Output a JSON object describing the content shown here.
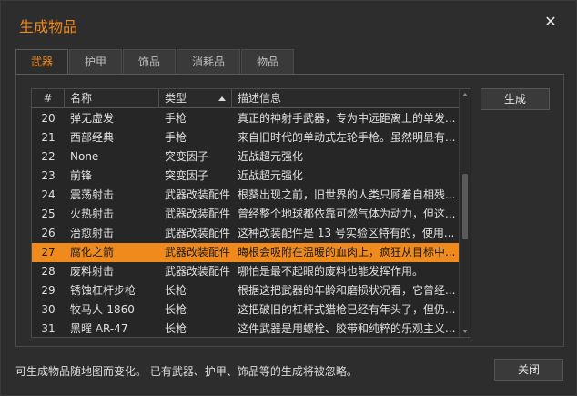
{
  "window": {
    "title": "生成物品",
    "close_symbol": "✕"
  },
  "tabs": [
    {
      "label": "武器",
      "active": true
    },
    {
      "label": "护甲",
      "active": false
    },
    {
      "label": "饰品",
      "active": false
    },
    {
      "label": "消耗品",
      "active": false
    },
    {
      "label": "物品",
      "active": false
    }
  ],
  "table": {
    "columns": {
      "num": "#",
      "name": "名称",
      "type": "类型",
      "desc": "描述信息"
    },
    "sort_column": "type",
    "sort_direction": "ascending",
    "selected_index": 27,
    "rows": [
      {
        "num": "20",
        "name": "弹无虚发",
        "type": "手枪",
        "desc": "真正的神射手武器，专为中远距离上的单发..."
      },
      {
        "num": "21",
        "name": "西部经典",
        "type": "手枪",
        "desc": "来自旧时代的单动式左轮手枪。虽然明显有..."
      },
      {
        "num": "22",
        "name": "None",
        "type": "突变因子",
        "desc": "近战超元强化"
      },
      {
        "num": "23",
        "name": "前锋",
        "type": "突变因子",
        "desc": "近战超元强化"
      },
      {
        "num": "24",
        "name": "震荡射击",
        "type": "武器改装配件",
        "desc": "根葵出现之前，旧世界的人类只顾着自相残..."
      },
      {
        "num": "25",
        "name": "火热射击",
        "type": "武器改装配件",
        "desc": "曾经整个地球都依靠可燃气体为动力，但这..."
      },
      {
        "num": "26",
        "name": "治愈射击",
        "type": "武器改装配件",
        "desc": "这种改装配件是 13 号实验区特有的，使用..."
      },
      {
        "num": "27",
        "name": "腐化之箭",
        "type": "武器改装配件",
        "desc": "晦根会吸附在温暖的血肉上，疯狂从目标中..."
      },
      {
        "num": "28",
        "name": "废料射击",
        "type": "武器改装配件",
        "desc": "哪怕是最不起眼的废料也能发挥作用。"
      },
      {
        "num": "29",
        "name": "锈蚀杠杆步枪",
        "type": "长枪",
        "desc": "根据这把武器的年龄和磨损状况看，它曾经..."
      },
      {
        "num": "30",
        "name": "牧马人-1860",
        "type": "长枪",
        "desc": "这把破旧的杠杆式猎枪已经有年头了，但仍..."
      },
      {
        "num": "31",
        "name": "黑曜 AR-47",
        "type": "长枪",
        "desc": "这件武器是用螺栓、胶带和纯粹的乐观主义..."
      }
    ],
    "scrollbar": {
      "position_fraction": 0.46
    }
  },
  "buttons": {
    "generate": "生成",
    "close": "关闭"
  },
  "footer": {
    "note": "可生成物品随地图而变化。 已有武器、护甲、饰品等的生成将被忽略。"
  },
  "colors": {
    "accent": "#f08a1c",
    "background": "#2d2d2d"
  }
}
